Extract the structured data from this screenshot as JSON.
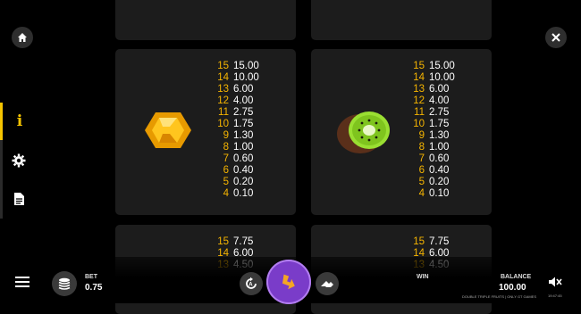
{
  "top_cards_partial": true,
  "left_card": {
    "symbol": "gem-icon",
    "paytable": [
      {
        "n": "15",
        "v": "15.00"
      },
      {
        "n": "14",
        "v": "10.00"
      },
      {
        "n": "13",
        "v": "6.00"
      },
      {
        "n": "12",
        "v": "4.00"
      },
      {
        "n": "11",
        "v": "2.75"
      },
      {
        "n": "10",
        "v": "1.75"
      },
      {
        "n": "9",
        "v": "1.30"
      },
      {
        "n": "8",
        "v": "1.00"
      },
      {
        "n": "7",
        "v": "0.60"
      },
      {
        "n": "6",
        "v": "0.40"
      },
      {
        "n": "5",
        "v": "0.20"
      },
      {
        "n": "4",
        "v": "0.10"
      }
    ]
  },
  "right_card": {
    "symbol": "kiwi-icon",
    "paytable": [
      {
        "n": "15",
        "v": "15.00"
      },
      {
        "n": "14",
        "v": "10.00"
      },
      {
        "n": "13",
        "v": "6.00"
      },
      {
        "n": "12",
        "v": "4.00"
      },
      {
        "n": "11",
        "v": "2.75"
      },
      {
        "n": "10",
        "v": "1.75"
      },
      {
        "n": "9",
        "v": "1.30"
      },
      {
        "n": "8",
        "v": "1.00"
      },
      {
        "n": "7",
        "v": "0.60"
      },
      {
        "n": "6",
        "v": "0.40"
      },
      {
        "n": "5",
        "v": "0.20"
      },
      {
        "n": "4",
        "v": "0.10"
      }
    ]
  },
  "lower_left_card": {
    "paytable": [
      {
        "n": "15",
        "v": "7.75"
      },
      {
        "n": "14",
        "v": "6.00"
      },
      {
        "n": "13",
        "v": "4.50"
      }
    ]
  },
  "lower_right_card": {
    "paytable": [
      {
        "n": "15",
        "v": "7.75"
      },
      {
        "n": "14",
        "v": "6.00"
      },
      {
        "n": "13",
        "v": "4.50"
      }
    ]
  },
  "sidebar": {
    "info": "i"
  },
  "footer": {
    "bet_label": "BET",
    "bet_value": "0.75",
    "win_label": "WIN",
    "balance_label": "BALANCE",
    "balance_value": "100.00",
    "game_name": "DOUBLE TRIPLE FRUITS | ONLY GT GAMES",
    "clock": "19:47:45"
  },
  "colors": {
    "accent": "#f5c400",
    "spin": "#7a3cc9"
  }
}
